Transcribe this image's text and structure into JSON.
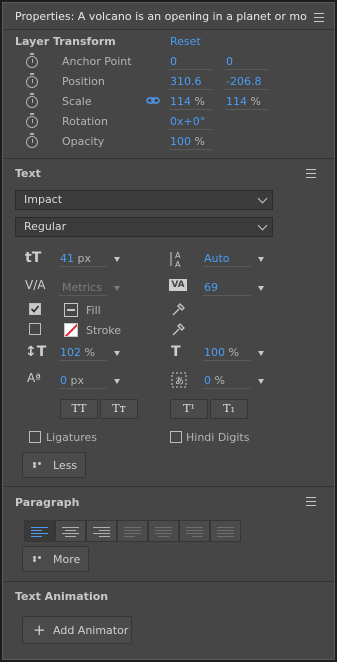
{
  "panel": {
    "title": "Properties: A volcano is an opening  in a planet or moon's cr"
  },
  "layer_transform": {
    "heading": "Layer Transform",
    "reset_label": "Reset",
    "rows": [
      {
        "label": "Anchor Point",
        "x": "0",
        "y": "0",
        "x_unit": "",
        "y_unit": ""
      },
      {
        "label": "Position",
        "x": "310.6",
        "y": "-206.8",
        "x_unit": "",
        "y_unit": ""
      },
      {
        "label": "Scale",
        "x": "114",
        "y": "114",
        "x_unit": "%",
        "y_unit": "%"
      },
      {
        "label": "Rotation",
        "x": "0",
        "x_unit": "x+0°"
      },
      {
        "label": "Opacity",
        "x": "100",
        "x_unit": "%"
      }
    ]
  },
  "text": {
    "heading": "Text",
    "font_family": "Impact",
    "font_style": "Regular",
    "font_size": "41",
    "font_size_unit": "px",
    "leading": "Auto",
    "kerning": "Metrics",
    "tracking": "69",
    "fill_label": "Fill",
    "stroke_label": "Stroke",
    "vertical_scale": "102",
    "vertical_scale_unit": "%",
    "horizontal_scale": "100",
    "horizontal_scale_unit": "%",
    "baseline_shift": "0",
    "baseline_shift_unit": "px",
    "tsume": "0",
    "tsume_unit": "%",
    "all_caps": "TT",
    "small_caps": "Tт",
    "superscript": "T¹",
    "subscript": "T₁",
    "ligatures_label": "Ligatures",
    "hindi_digits_label": "Hindi Digits",
    "less_label": "Less",
    "fill_checked": true,
    "stroke_checked": false,
    "ligatures_checked": false,
    "hindi_digits_checked": false
  },
  "paragraph": {
    "heading": "Paragraph",
    "more_label": "More"
  },
  "text_animation": {
    "heading": "Text Animation",
    "add_animator_label": "Add Animator"
  },
  "colors": {
    "panel_bg": "#464646",
    "accent_blue": "#4a9df7",
    "stroke_swatch_red": "#e0262f"
  }
}
